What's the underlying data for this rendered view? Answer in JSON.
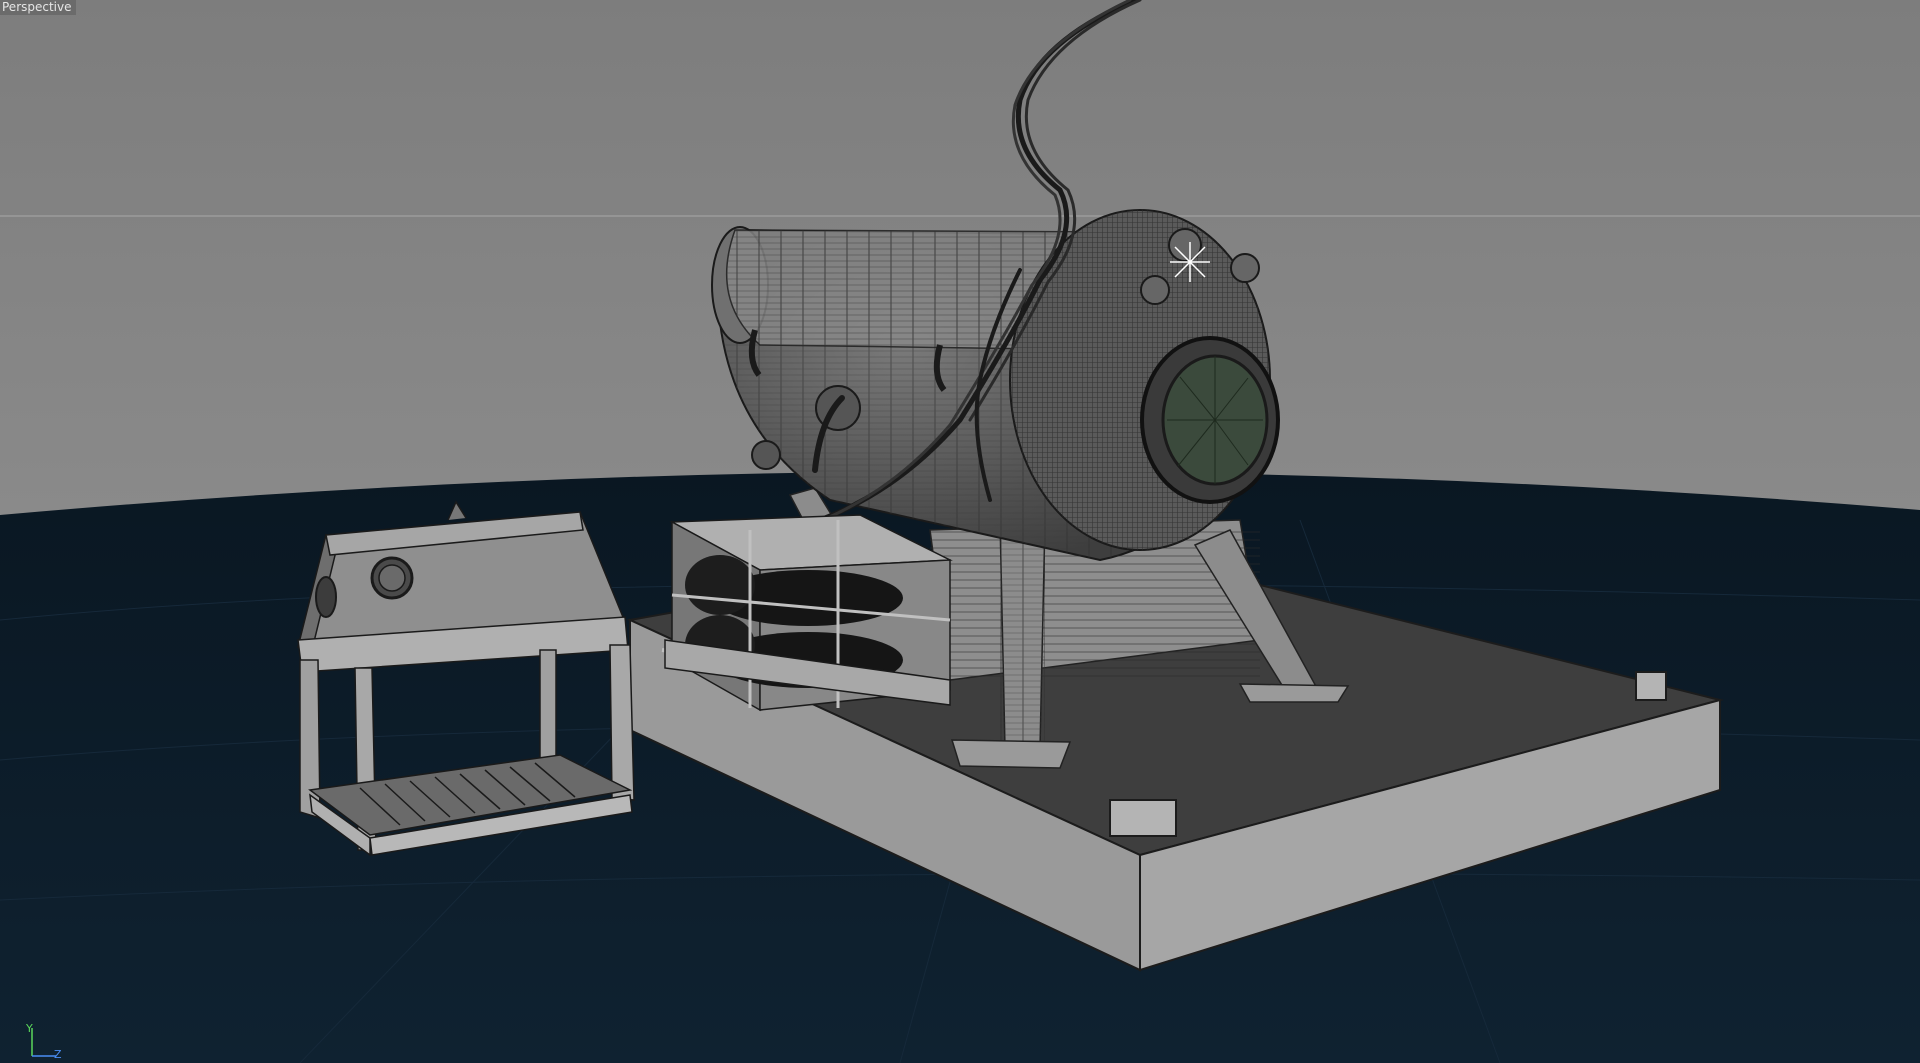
{
  "viewport": {
    "camera_label": "Perspective",
    "background_color": "#808080",
    "ground_color": "#0d1d2b"
  },
  "axis_gizmo": {
    "y_label": "Y",
    "z_label": "Z",
    "y_color": "#5ad65a",
    "z_color": "#4a8ef5"
  },
  "scene": {
    "objects": [
      {
        "name": "pressure-tank-cylinder"
      },
      {
        "name": "tank-front-dome"
      },
      {
        "name": "tank-support-legs"
      },
      {
        "name": "cable-bundle"
      },
      {
        "name": "gas-cylinder-rack"
      },
      {
        "name": "hopper-cabinet"
      },
      {
        "name": "concrete-base-platform"
      }
    ]
  }
}
